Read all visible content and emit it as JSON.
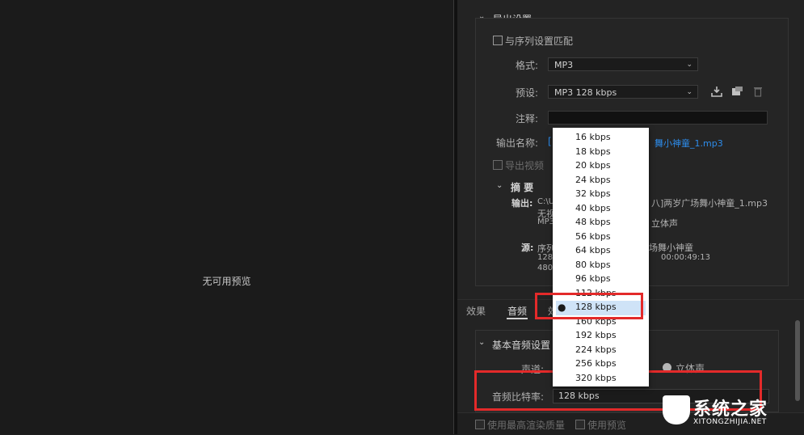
{
  "preview": {
    "no_preview": "无可用预览"
  },
  "export_settings": {
    "title": "导出设置",
    "match_sequence": "与序列设置匹配",
    "format_label": "格式:",
    "format_value": "MP3",
    "preset_label": "预设:",
    "preset_value": "MP3 128 kbps",
    "comment_label": "注释:",
    "comment_value": "",
    "output_name_label": "输出名称:",
    "output_name_prefix": "[",
    "output_name_suffix": "舞小神童_1.mp3",
    "export_video": "导出视频"
  },
  "summary": {
    "title": "摘 要",
    "output_label": "输出:",
    "output_line1_a": "C:\\U",
    "output_line1_b": "八]两岁广场舞小神童_1.mp3",
    "output_line2": "无视",
    "output_line3_a": "MP3",
    "output_line3_b": "立体声",
    "source_label": "源:",
    "source_line1_a": "序列",
    "source_line1_b": "场舞小神童",
    "source_line2_a": "1280",
    "source_line2_b": "00:00:49:13",
    "source_line3": "4800"
  },
  "tabs": {
    "effects": "效果",
    "audio": "音频",
    "third_partial": "效"
  },
  "audio": {
    "basic_title": "基本音频设置",
    "channel_label": "声道:",
    "stereo_label": "立体声",
    "bitrate_label": "音频比特率:",
    "bitrate_value": "128 kbps"
  },
  "dropdown": {
    "options": [
      "16 kbps",
      "18 kbps",
      "20 kbps",
      "24 kbps",
      "32 kbps",
      "40 kbps",
      "48 kbps",
      "56 kbps",
      "64 kbps",
      "80 kbps",
      "96 kbps",
      "112 kbps",
      "128 kbps",
      "160 kbps",
      "192 kbps",
      "224 kbps",
      "256 kbps",
      "320 kbps"
    ],
    "selected": "128 kbps"
  },
  "bottom": {
    "max_render_quality": "使用最高渲染质量",
    "use_previews": "使用预览"
  },
  "watermark": {
    "brand": "系统之家",
    "url": "XITONGZHIJIA.NET"
  },
  "colors": {
    "accent_blue": "#2d8ceb",
    "highlight_red": "#e32a2a",
    "selected_option_bg": "#cfe3f7"
  }
}
